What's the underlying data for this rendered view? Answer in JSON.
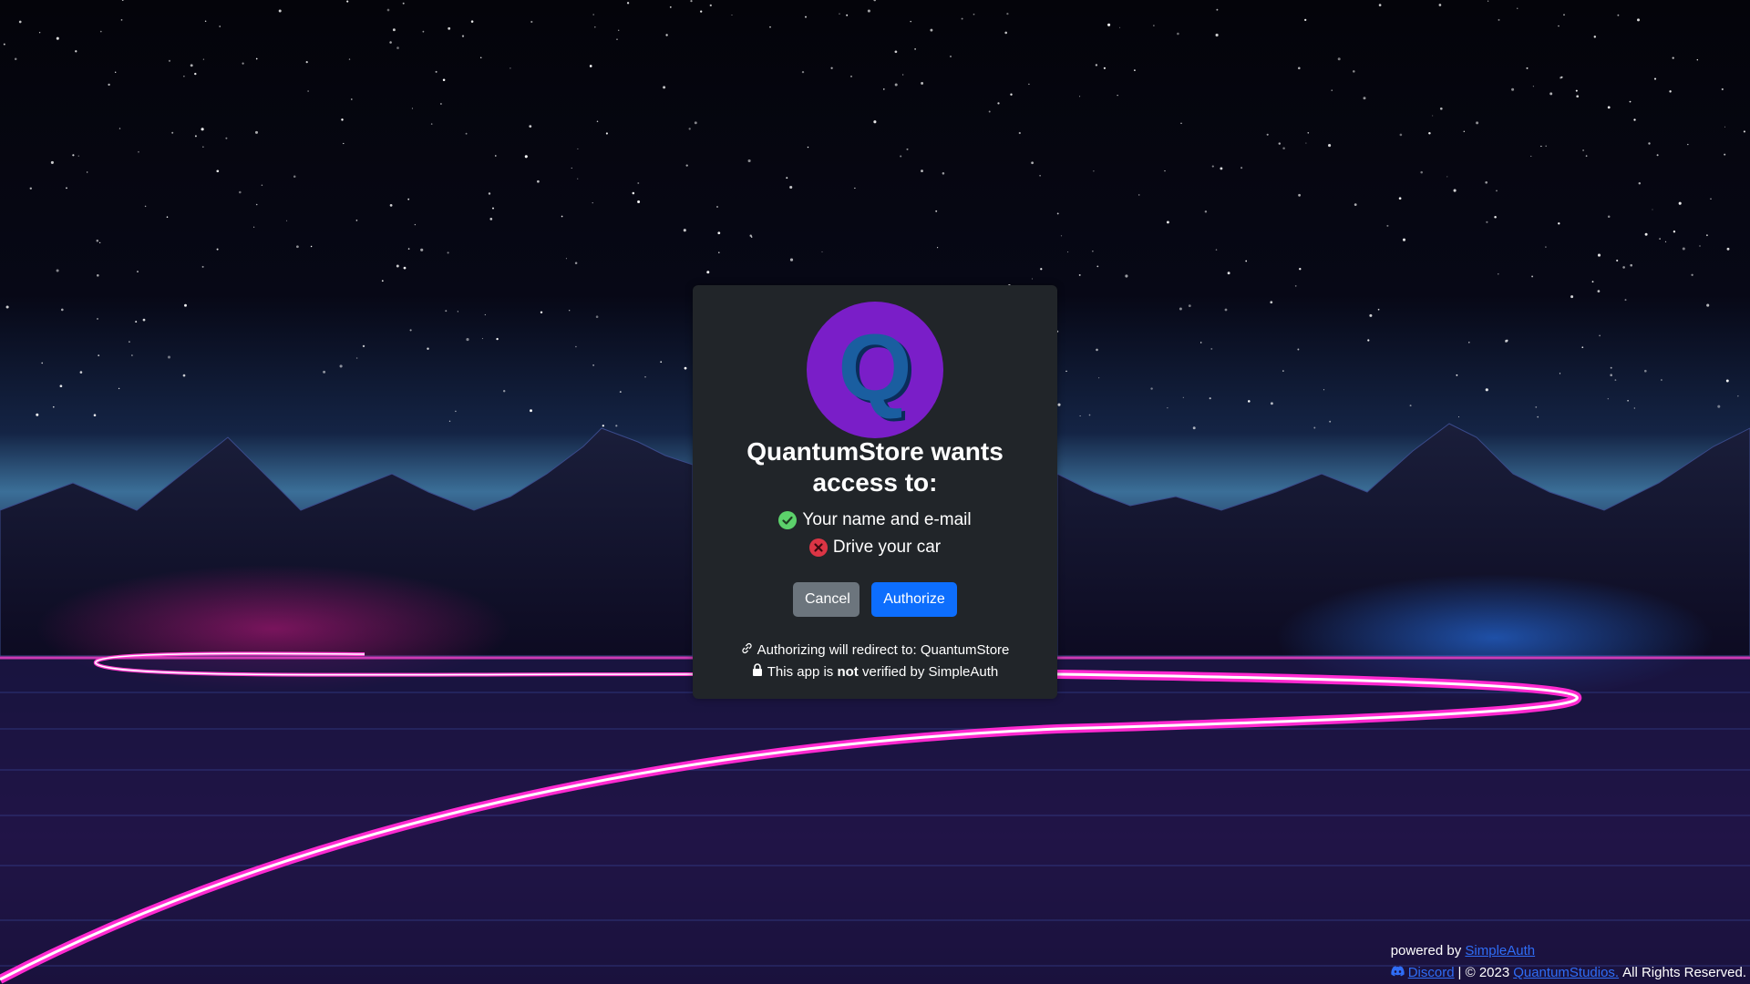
{
  "dialog": {
    "title": "QuantumStore wants access to:",
    "logo_letter": "Q",
    "permissions": [
      {
        "label": "Your name and e-mail",
        "status": "allowed",
        "icon": "check-circle-icon",
        "color": "#5cd16b"
      },
      {
        "label": "Drive your car",
        "status": "denied",
        "icon": "x-circle-icon",
        "color": "#dc3545"
      }
    ],
    "cancel_label": "Cancel",
    "authorize_label": "Authorize",
    "redirect_text": "Authorizing will redirect to: QuantumStore",
    "verified_prefix": "This app is",
    "verified_bold": "not",
    "verified_suffix": "verified by SimpleAuth"
  },
  "footer": {
    "powered_by": "powered by",
    "powered_link": "SimpleAuth",
    "discord_label": "Discord",
    "copyright": "| © 2023",
    "studio_link": "QuantumStudios.",
    "rights": "All Rights Reserved."
  },
  "colors": {
    "card_bg": "#212529",
    "cancel_bg": "#6c757d",
    "authorize_bg": "#0d6efd",
    "logo_circle": "#7a1ec8",
    "logo_letter": "#1a5ea0",
    "link": "#2f6df6"
  }
}
